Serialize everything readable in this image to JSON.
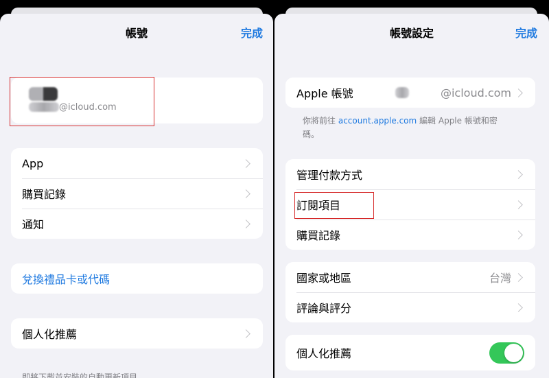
{
  "left": {
    "title": "帳號",
    "done_label": "完成",
    "account_email": "@icloud.com",
    "menu_items": [
      "App",
      "購買記錄",
      "通知"
    ],
    "redeem_label": "兌換禮品卡或代碼",
    "personalized_label": "個人化推薦",
    "footnote": "即將下載並安裝的自動更新項目"
  },
  "right": {
    "title": "帳號設定",
    "done_label": "完成",
    "apple_account_label": "Apple 帳號",
    "apple_account_email": "@icloud.com",
    "note_prefix": "你將前往",
    "note_link": "account.apple.com",
    "note_suffix": "編輯 Apple 帳號和密碼。",
    "payment_items": [
      "管理付款方式",
      "訂閱項目",
      "購買記錄"
    ],
    "country_label": "國家或地區",
    "country_value": "台灣",
    "ratings_label": "評論與評分",
    "personalized_label": "個人化推薦",
    "personalized_on": true
  },
  "colors": {
    "accent": "#1f7ae0",
    "toggle_on": "#34c759",
    "highlight": "#d62a2a",
    "panel_bg": "#f2f2f7"
  }
}
